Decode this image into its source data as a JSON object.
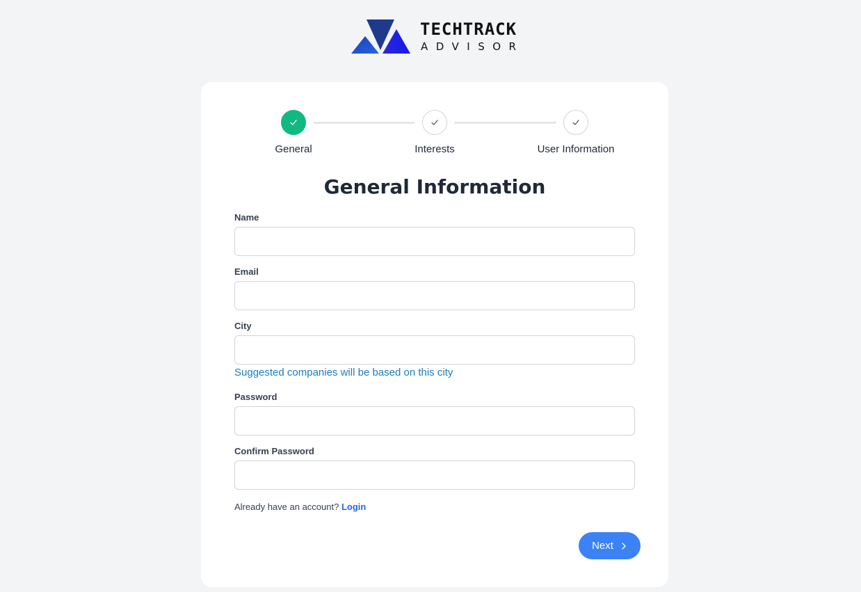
{
  "brand": {
    "line1": "TECHTRACK",
    "line2": "ADVISOR",
    "colors": {
      "dark": "#1e3a8a",
      "blue": "#2231e8",
      "mid": "#1d4ed8"
    }
  },
  "stepper": {
    "steps": [
      {
        "label": "General",
        "status": "complete"
      },
      {
        "label": "Interests",
        "status": "pending"
      },
      {
        "label": "User Information",
        "status": "pending"
      }
    ],
    "complete_color": "#10b981"
  },
  "form": {
    "title": "General Information",
    "fields": [
      {
        "label": "Name",
        "value": "",
        "placeholder": ""
      },
      {
        "label": "Email",
        "value": "",
        "placeholder": ""
      },
      {
        "label": "City",
        "value": "",
        "placeholder": ""
      },
      {
        "label": "Password",
        "value": "",
        "placeholder": ""
      },
      {
        "label": "Confirm Password",
        "value": "",
        "placeholder": ""
      }
    ],
    "city_hint": "Suggested companies will be based on this city",
    "account_prompt": "Already have an account?",
    "login_link": "Login",
    "next_label": "Next",
    "accent_color": "#3b82f6"
  }
}
